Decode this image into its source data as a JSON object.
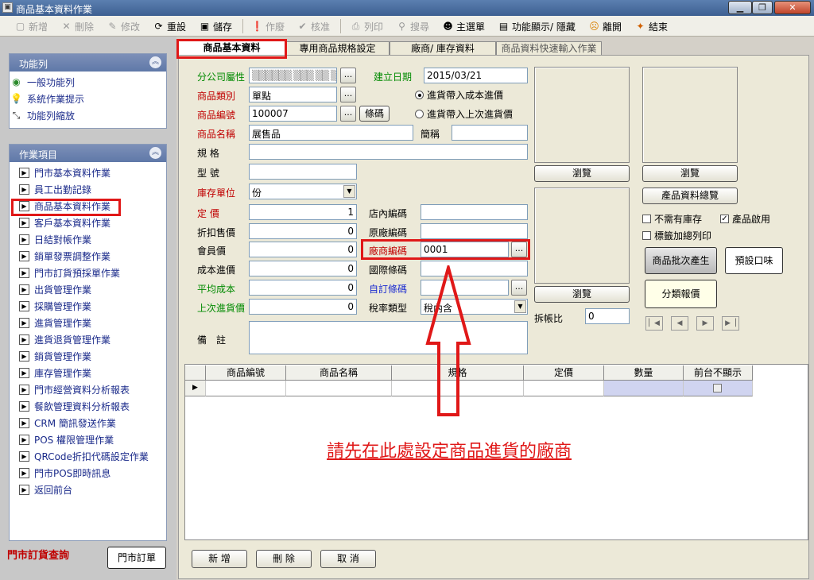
{
  "window": {
    "title": "商品基本資料作業",
    "icon": "window-icon",
    "min": "▁",
    "restore": "❐",
    "close": "✕"
  },
  "toolbar": {
    "new": "新增",
    "delete": "刪除",
    "edit": "修改",
    "reset": "重設",
    "save": "儲存",
    "void": "作廢",
    "approve": "核准",
    "print": "列印",
    "search": "搜尋",
    "main_menu": "主選單",
    "toggle_func": "功能顯示/ 隱藏",
    "leave": "離開",
    "exit": "結束"
  },
  "sidebar": {
    "func_title": "功能列",
    "func_items": [
      {
        "label": "一般功能列",
        "icon": "globe-icon"
      },
      {
        "label": "系統作業提示",
        "icon": "lightbulb-icon"
      },
      {
        "label": "功能列縮放",
        "icon": "resize-icon"
      }
    ],
    "ops_title": "作業項目",
    "ops_items": [
      {
        "label": "門市基本資料作業"
      },
      {
        "label": "員工出勤記錄"
      },
      {
        "label": "商品基本資料作業"
      },
      {
        "label": "客戶基本資料作業"
      },
      {
        "label": "日結對帳作業"
      },
      {
        "label": "銷單發票調整作業"
      },
      {
        "label": "門市訂貨預採單作業"
      },
      {
        "label": "出貨管理作業"
      },
      {
        "label": "採購管理作業"
      },
      {
        "label": "進貨管理作業"
      },
      {
        "label": "進貨退貨管理作業"
      },
      {
        "label": "銷貨管理作業"
      },
      {
        "label": "庫存管理作業"
      },
      {
        "label": "門市經營資料分析報表"
      },
      {
        "label": "餐飲管理資料分析報表"
      },
      {
        "label": "CRM 簡訊發送作業"
      },
      {
        "label": "POS 權限管理作業"
      },
      {
        "label": "QRCode折扣代碼設定作業"
      },
      {
        "label": "門市POS即時訊息"
      },
      {
        "label": "返回前台"
      }
    ],
    "store_order_query": "門市訂貨查詢",
    "store_order_btn": "門市訂單"
  },
  "tabs": [
    "商品基本資料",
    "專用商品規格設定",
    "廠商/ 庫存資料",
    "商品資料快速輸入作業"
  ],
  "form": {
    "branch_label": "分公司屬性",
    "branch_value": "▒▒▒▒▒▒ ▒▒▒ ▒▒ ▒.",
    "created_label": "建立日期",
    "created_value": "2015/03/21",
    "category_label": "商品類別",
    "category_value": "單點",
    "radio1": "進貨帶入成本進價",
    "radio2": "進貨帶入上次進貨價",
    "code_label": "商品編號",
    "code_value": "100007",
    "barcode_btn": "條碼",
    "name_label": "商品名稱",
    "name_value": "展售品",
    "short_label": "簡稱",
    "short_value": "",
    "spec_label": "規 格",
    "spec_value": "",
    "model_label": "型 號",
    "model_value": "",
    "unit_label": "庫存單位",
    "unit_value": "份",
    "price_label": "定 價",
    "price_value": "1",
    "store_code_label": "店內編碼",
    "store_code_value": "",
    "discount_label": "折扣售價",
    "discount_value": "0",
    "orig_code_label": "原廠編碼",
    "orig_code_value": "",
    "member_label": "會員價",
    "member_value": "0",
    "vendor_label": "廠商編碼",
    "vendor_value": "0001",
    "cost_label": "成本進價",
    "cost_value": "0",
    "intl_label": "國際條碼",
    "intl_value": "",
    "avg_label": "平均成本",
    "avg_value": "0",
    "custom_label": "自訂條碼",
    "custom_value": "",
    "last_label": "上次進貨價",
    "last_value": "0",
    "tax_label": "稅率類型",
    "tax_value": "稅內含",
    "note_label": "備　註",
    "note_value": "",
    "split_label": "拆帳比",
    "split_value": "0"
  },
  "right": {
    "browse": "瀏覽",
    "overview_btn": "產品資料總覽",
    "no_stock": "不需有庫存",
    "enabled": "產品啟用",
    "label_print": "標籤加總列印",
    "batch_btn": "商品批次產生",
    "default_flavor_btn": "預設口味",
    "class_price_btn": "分類報價"
  },
  "grid": {
    "headers": [
      "商品編號",
      "商品名稱",
      "規格",
      "定價",
      "數量",
      "前台不顯示"
    ]
  },
  "annotation": "請先在此處設定商品進貨的廠商",
  "bottom": {
    "add": "新 增",
    "delete": "刪 除",
    "cancel": "取 消"
  }
}
